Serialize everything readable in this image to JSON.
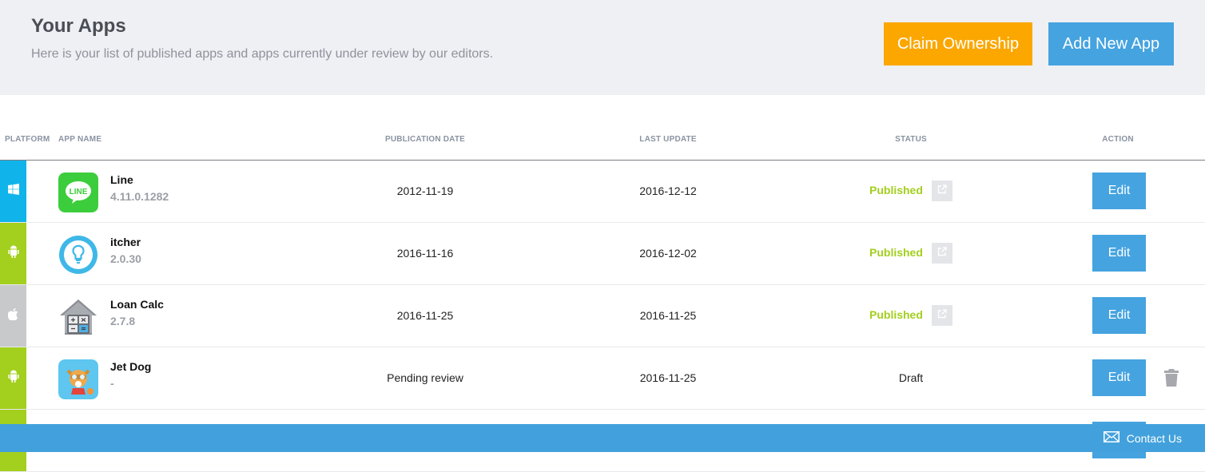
{
  "header": {
    "title": "Your Apps",
    "subtitle": "Here is your list of published apps and apps currently under review by our editors.",
    "claim_button": "Claim Ownership",
    "add_button": "Add New App"
  },
  "table": {
    "columns": {
      "platform": "PLATFORM",
      "app_name": "APP NAME",
      "publication_date": "PUBLICATION DATE",
      "last_update": "LAST UPDATE",
      "status": "STATUS",
      "action": "ACTION"
    },
    "rows": [
      {
        "platform": "windows",
        "name": "Line",
        "version": "4.11.0.1282",
        "publication_date": "2012-11-19",
        "last_update": "2016-12-12",
        "status": "Published",
        "action": "Edit"
      },
      {
        "platform": "android",
        "name": "itcher",
        "version": "2.0.30",
        "publication_date": "2016-11-16",
        "last_update": "2016-12-02",
        "status": "Published",
        "action": "Edit"
      },
      {
        "platform": "apple",
        "name": "Loan Calc",
        "version": "2.7.8",
        "publication_date": "2016-11-25",
        "last_update": "2016-11-25",
        "status": "Published",
        "action": "Edit"
      },
      {
        "platform": "android",
        "name": "Jet Dog",
        "version": "-",
        "publication_date": "Pending review",
        "last_update": "2016-11-25",
        "status": "Draft",
        "action": "Edit"
      }
    ]
  },
  "colors": {
    "windows": "#10b4ea",
    "android": "#a3cf1e",
    "apple": "#c8c9cb",
    "published": "#a3cf1e",
    "claim": "#fba700",
    "primary": "#45a3e0"
  },
  "icons": {
    "platforms": [
      "windows-icon",
      "android-icon",
      "apple-icon",
      "android-icon"
    ],
    "external_link": "external-link-icon",
    "delete": "trash-icon",
    "contact": "envelope-icon"
  },
  "footer": {
    "contact_label": "Contact Us"
  }
}
